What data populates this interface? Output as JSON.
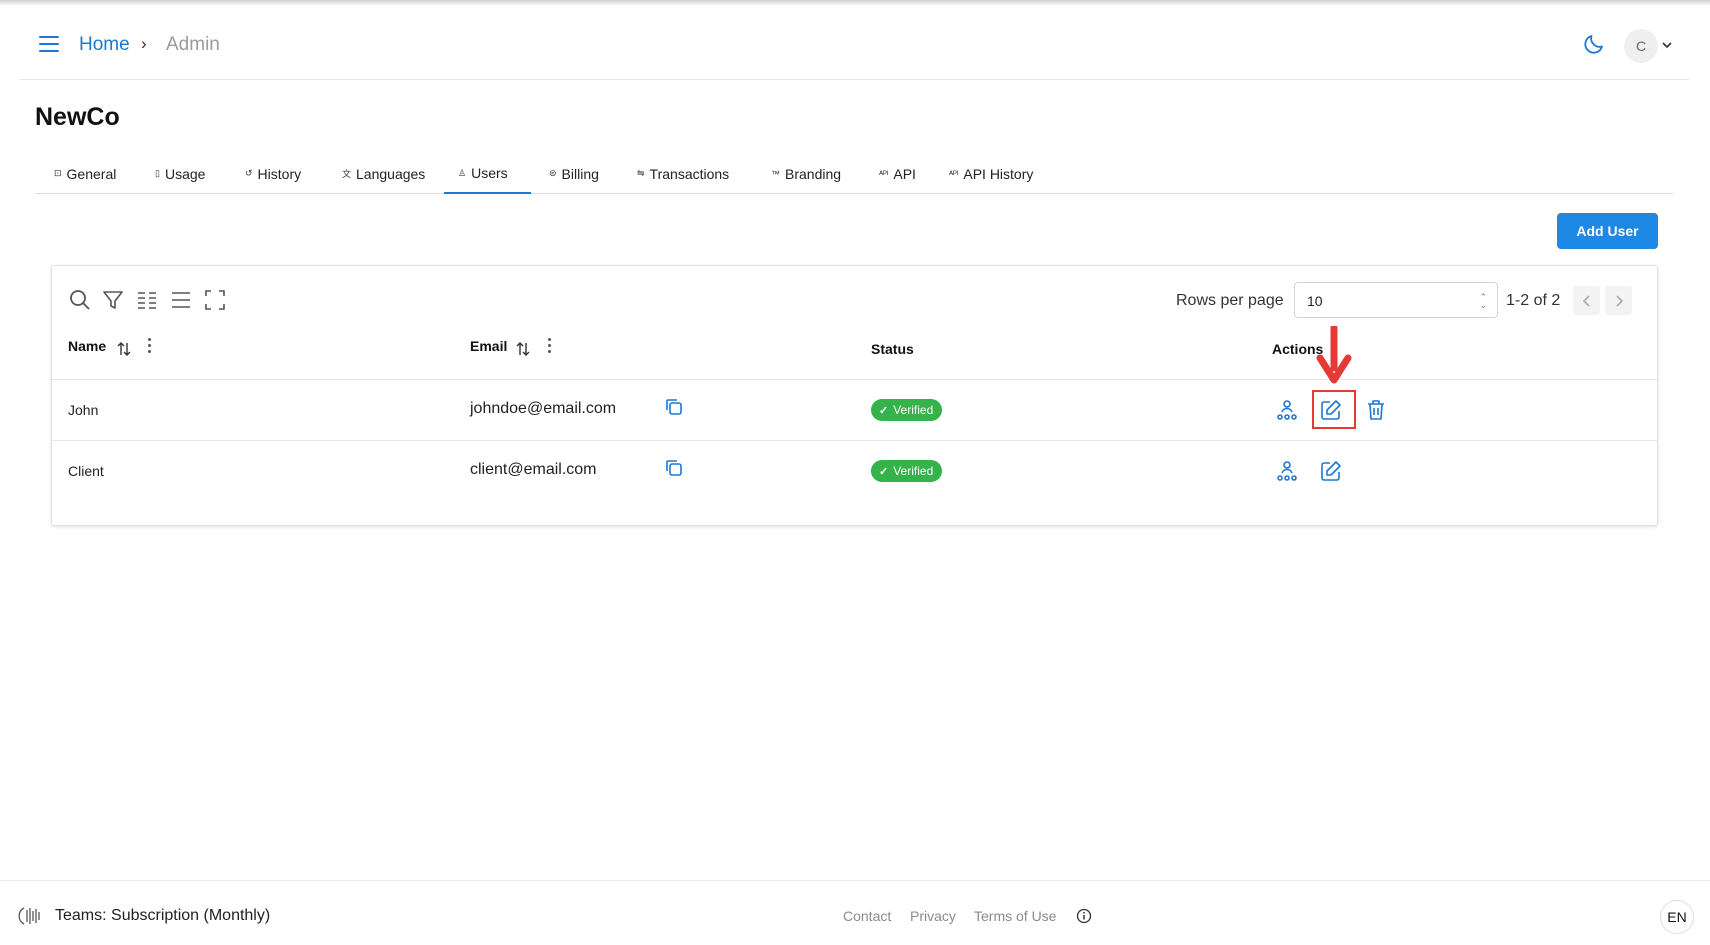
{
  "header": {
    "breadcrumb": {
      "home": "Home",
      "separator": "›",
      "current": "Admin"
    },
    "avatar_initial": "C"
  },
  "org_name": "NewCo",
  "tabs": [
    {
      "label": "General",
      "icon": "info-square-icon",
      "glyph": "⊡"
    },
    {
      "label": "Usage",
      "icon": "database-icon",
      "glyph": "▯"
    },
    {
      "label": "History",
      "icon": "history-icon",
      "glyph": "↺"
    },
    {
      "label": "Languages",
      "icon": "translate-icon",
      "glyph": "文"
    },
    {
      "label": "Users",
      "icon": "user-icon",
      "glyph": "♙"
    },
    {
      "label": "Billing",
      "icon": "billing-icon",
      "glyph": "⊜"
    },
    {
      "label": "Transactions",
      "icon": "transactions-icon",
      "glyph": "⇋"
    },
    {
      "label": "Branding",
      "icon": "trademark-icon",
      "glyph": "™"
    },
    {
      "label": "API",
      "icon": "api-icon",
      "glyph": "ᴬᴾᴵ"
    },
    {
      "label": "API History",
      "icon": "api-icon",
      "glyph": "ᴬᴾᴵ"
    }
  ],
  "active_tab": "Users",
  "add_user_label": "Add User",
  "table": {
    "rows_per_page_label": "Rows per page",
    "rows_per_page_value": "10",
    "page_count": "1-2 of 2",
    "columns": {
      "name": "Name",
      "email": "Email",
      "status": "Status",
      "actions": "Actions"
    },
    "rows": [
      {
        "name": "John",
        "email": "johndoe@email.com",
        "status": "Verified"
      },
      {
        "name": "Client",
        "email": "client@email.com",
        "status": "Verified"
      }
    ]
  },
  "footer": {
    "plan": "Teams: Subscription (Monthly)",
    "links": {
      "contact": "Contact",
      "privacy": "Privacy",
      "terms": "Terms of Use"
    },
    "language": "EN"
  },
  "colors": {
    "accent": "#1e78d2",
    "button": "#1e88e5",
    "verified": "#34b34a",
    "highlight": "#e53935"
  }
}
